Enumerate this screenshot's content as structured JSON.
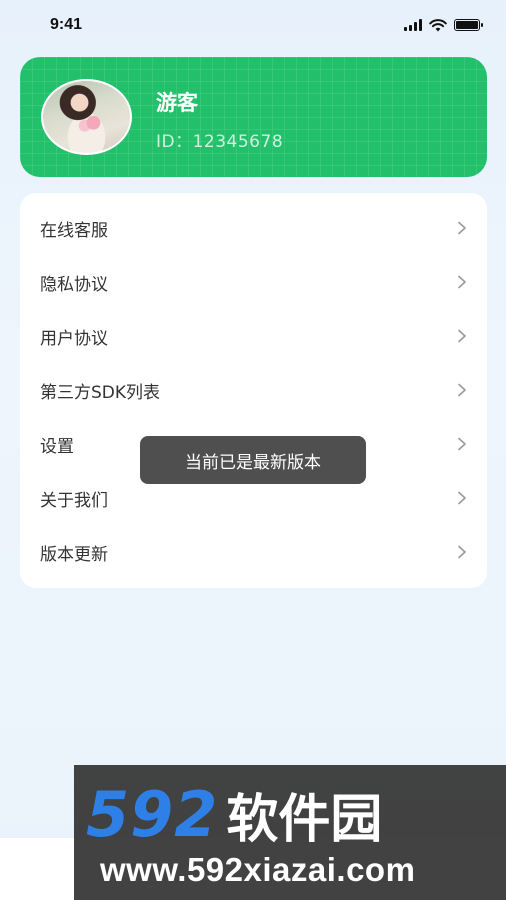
{
  "status_bar": {
    "time": "9:41",
    "icons": [
      "signal-icon",
      "wifi-icon",
      "battery-icon"
    ]
  },
  "profile": {
    "name": "游客",
    "id_text": "ID：12345678",
    "accent_color": "#22c06a"
  },
  "menu": {
    "items": [
      {
        "label": "在线客服"
      },
      {
        "label": "隐私协议"
      },
      {
        "label": "用户协议"
      },
      {
        "label": "第三方SDK列表"
      },
      {
        "label": "设置"
      },
      {
        "label": "关于我们"
      },
      {
        "label": "版本更新"
      }
    ],
    "chevron_icon": "chevron-right-icon"
  },
  "toast": {
    "message": "当前已是最新版本"
  },
  "watermark": {
    "number": "592",
    "brand": "软件园",
    "url": "www.592xiazai.com",
    "number_color": "#2e7fe6"
  }
}
